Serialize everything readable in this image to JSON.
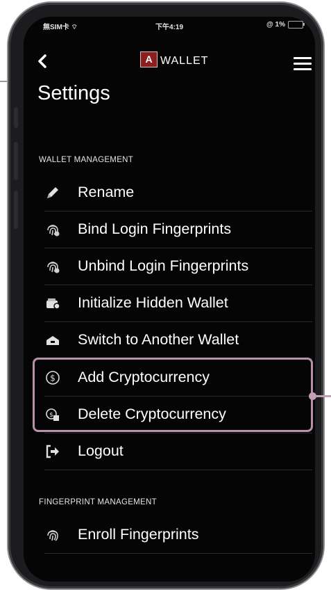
{
  "status_bar": {
    "carrier": "無SIM卡 ⌔",
    "time": "下午4:19",
    "battery": "@ 1%"
  },
  "navbar": {
    "back_icon": "chevron-left-icon",
    "logo_mark": "A",
    "brand": "WALLET",
    "menu_icon": "hamburger-menu-icon"
  },
  "page_title": "Settings",
  "wallet_management": {
    "header": "WALLET MANAGEMENT",
    "items": [
      {
        "label": "Rename",
        "icon": "pencil-icon"
      },
      {
        "label": "Bind Login Fingerprints",
        "icon": "fingerprint-icon"
      },
      {
        "label": "Unbind Login Fingerprints",
        "icon": "fingerprint-icon"
      },
      {
        "label": "Initialize Hidden Wallet",
        "icon": "wallet-icon"
      },
      {
        "label": "Switch to Another Wallet",
        "icon": "switch-wallet-icon"
      },
      {
        "label": "Add Cryptocurrency",
        "icon": "dollar-circle-icon"
      },
      {
        "label": "Delete Cryptocurrency",
        "icon": "delete-currency-icon"
      },
      {
        "label": "Logout",
        "icon": "logout-icon"
      }
    ]
  },
  "fingerprint_management": {
    "header": "FINGERPRINT MANAGEMENT",
    "items": [
      {
        "label": "Enroll Fingerprints",
        "icon": "fingerprint-icon"
      }
    ]
  },
  "colors": {
    "screen_background": "#050505",
    "highlight_border": "#b890aa",
    "logo_red": "#8a1f1f"
  }
}
